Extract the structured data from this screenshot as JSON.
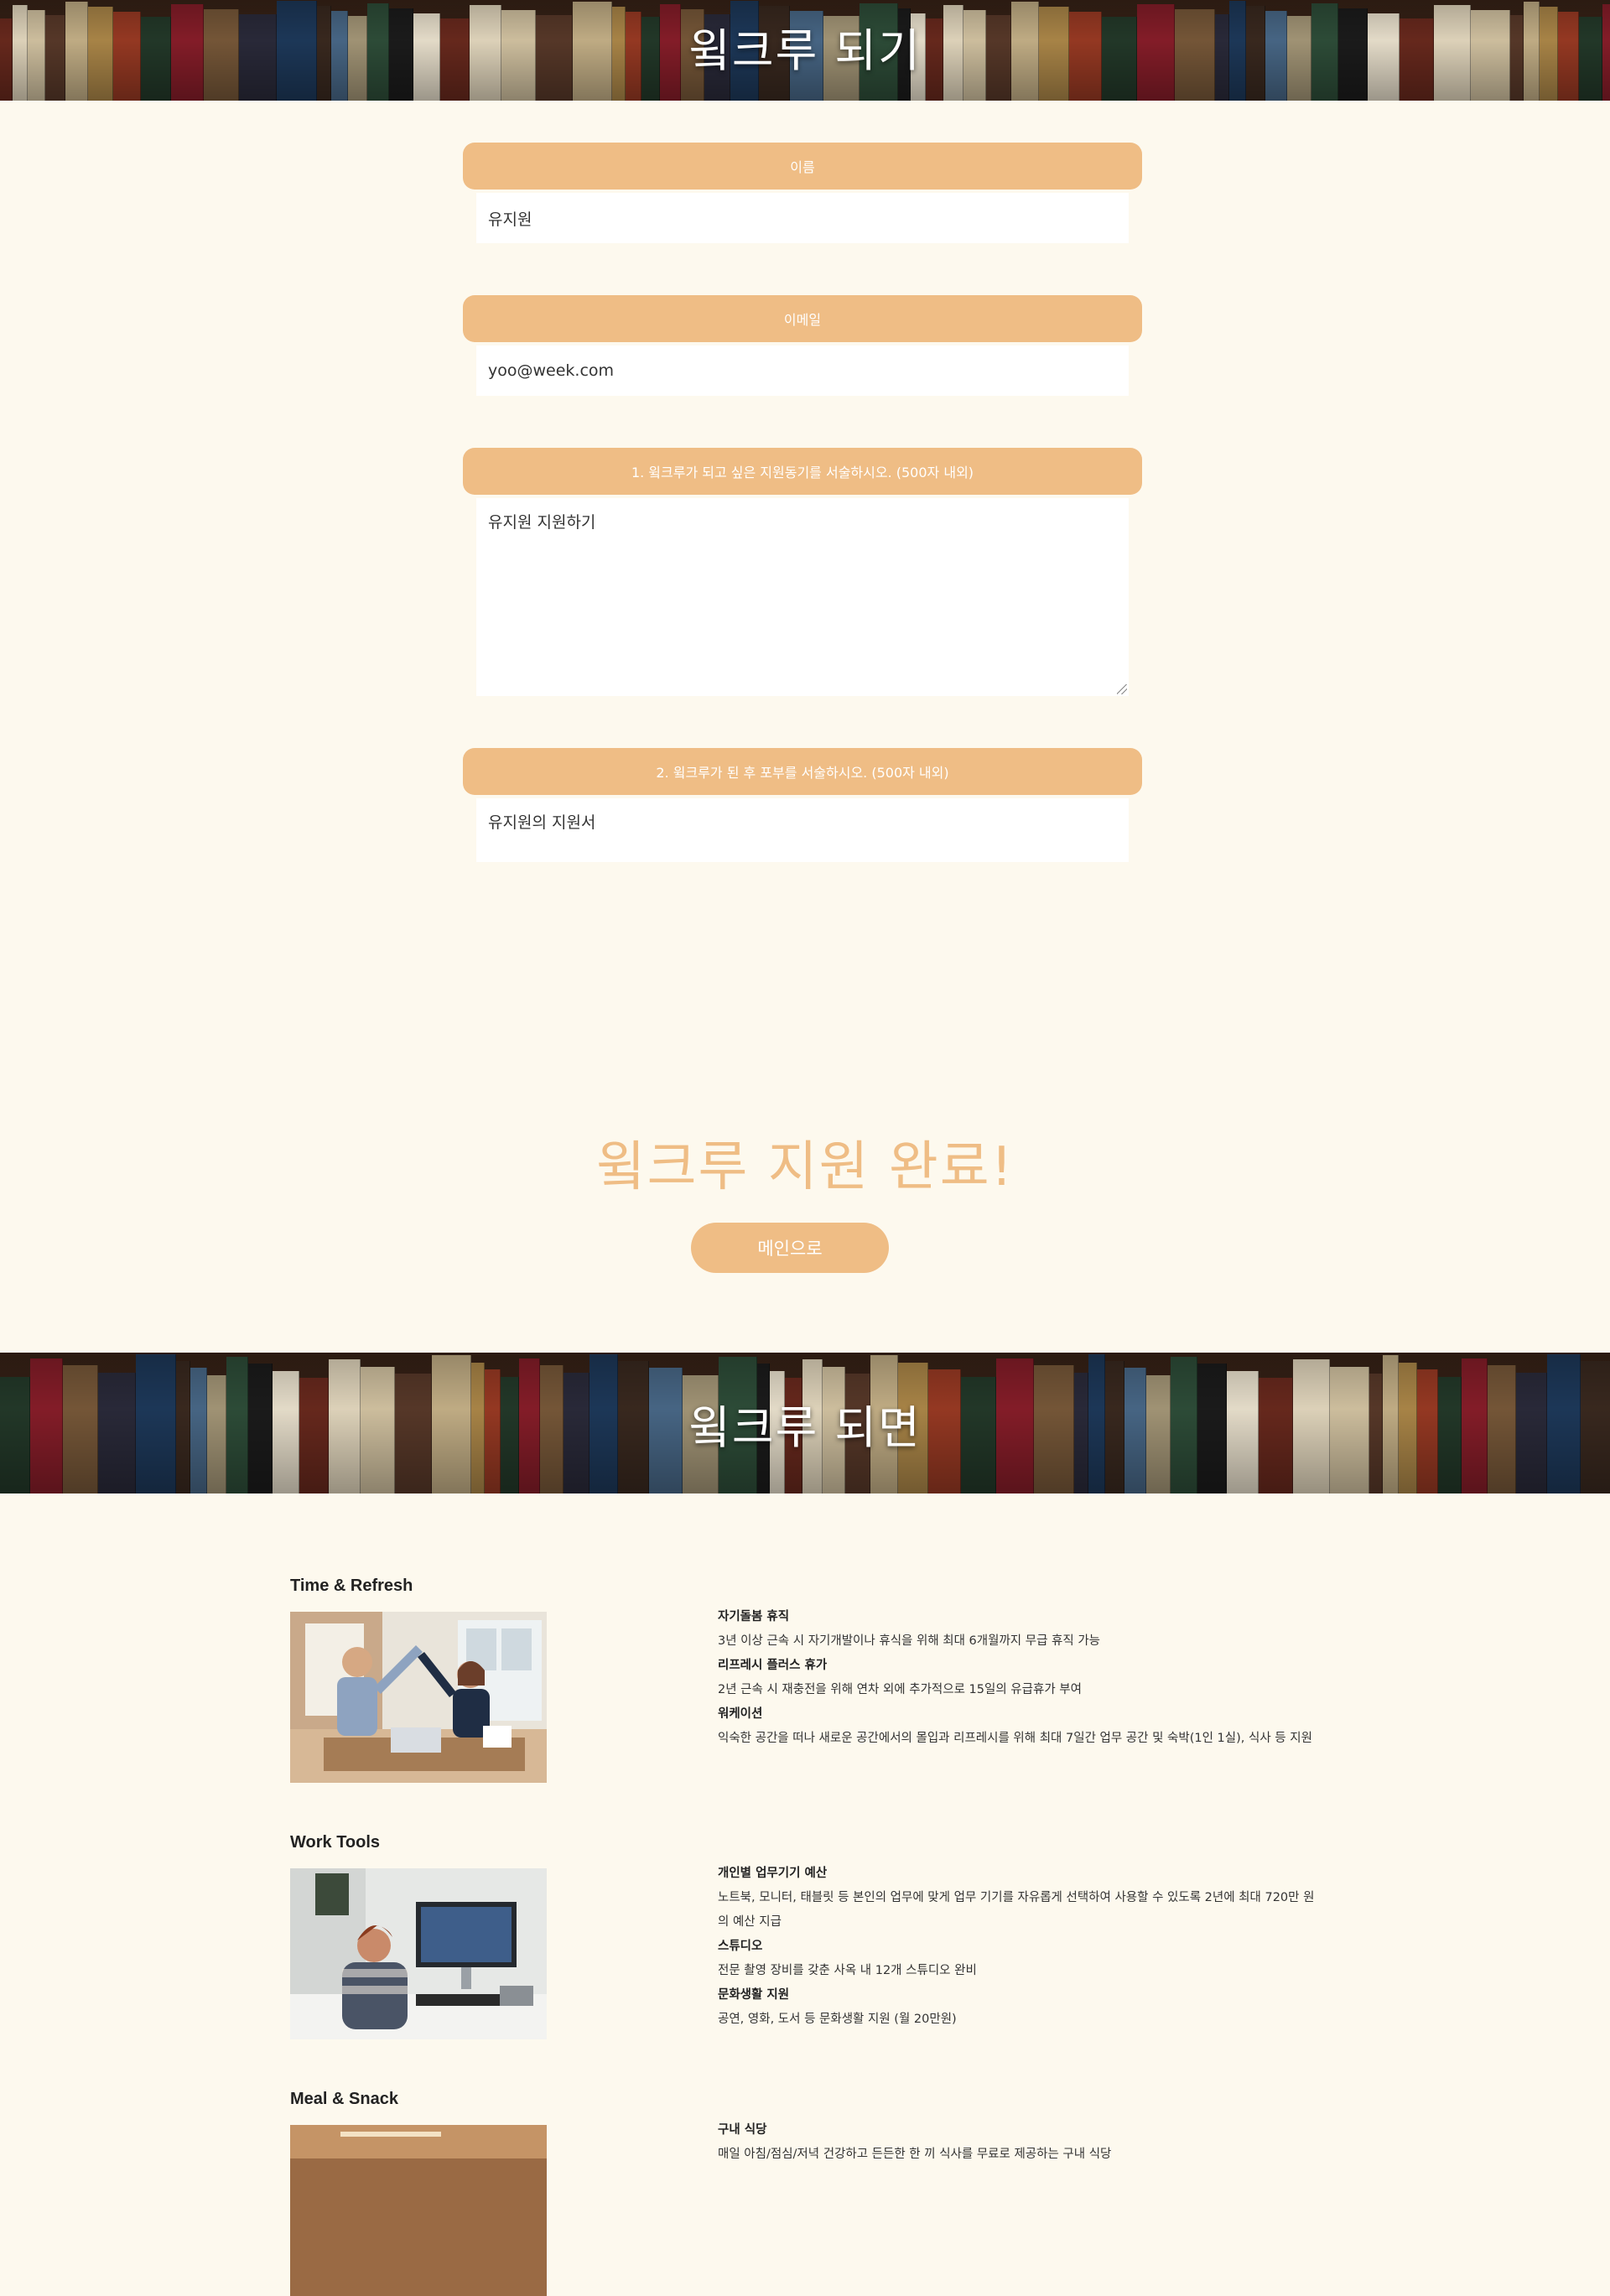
{
  "banner_top": {
    "title": "윜크루 되기"
  },
  "form": {
    "fields": [
      {
        "label": "이름",
        "value": "유지원"
      },
      {
        "label": "이메일",
        "value": "yoo@week.com"
      },
      {
        "label": "1. 윜크루가 되고 싶은 지원동기를 서술하시오. (500자 내외)",
        "value": "유지원 지원하기"
      },
      {
        "label": "2. 윜크루가 된 후 포부를 서술하시오. (500자 내외)",
        "value": "유지원의 지원서"
      }
    ]
  },
  "complete": {
    "title": "윜크루 지원 완료!",
    "button": "메인으로"
  },
  "banner_bottom": {
    "title": "윜크루 되면"
  },
  "benefits": [
    {
      "heading": "Time & Refresh",
      "items": [
        {
          "title": "자기돌봄 휴직",
          "desc": "3년 이상 근속 시 자기개발이나 휴식을 위해 최대 6개월까지 무급 휴직 가능"
        },
        {
          "title": "리프레시 플러스 휴가",
          "desc": "2년 근속 시 재충전을 위해 연차 외에 추가적으로 15일의 유급휴가 부여"
        },
        {
          "title": "워케이션",
          "desc": "익숙한 공간을 떠나 새로운 공간에서의 몰입과 리프레시를 위해 최대 7일간 업무 공간 및 숙박(1인 1실), 식사 등 지원"
        }
      ]
    },
    {
      "heading": "Work Tools",
      "items": [
        {
          "title": "개인별 업무기기 예산",
          "desc": "노트북, 모니터, 태블릿 등 본인의 업무에 맞게 업무 기기를 자유롭게 선택하여 사용할 수 있도록 2년에 최대 720만 원의 예산 지급"
        },
        {
          "title": "스튜디오",
          "desc": "전문 촬영 장비를 갖춘 사옥 내 12개 스튜디오 완비"
        },
        {
          "title": "문화생활 지원",
          "desc": "공연, 영화, 도서 등 문화생활 지원 (월 20만원)"
        }
      ]
    },
    {
      "heading": "Meal & Snack",
      "items": [
        {
          "title": "구내 식당",
          "desc": "매일 아침/점심/저녁 건강하고 든든한 한 끼 식사를 무료로 제공하는 구내 식당"
        }
      ]
    }
  ],
  "colors": {
    "accent": "#efbd85",
    "background": "#fdf9ee"
  }
}
